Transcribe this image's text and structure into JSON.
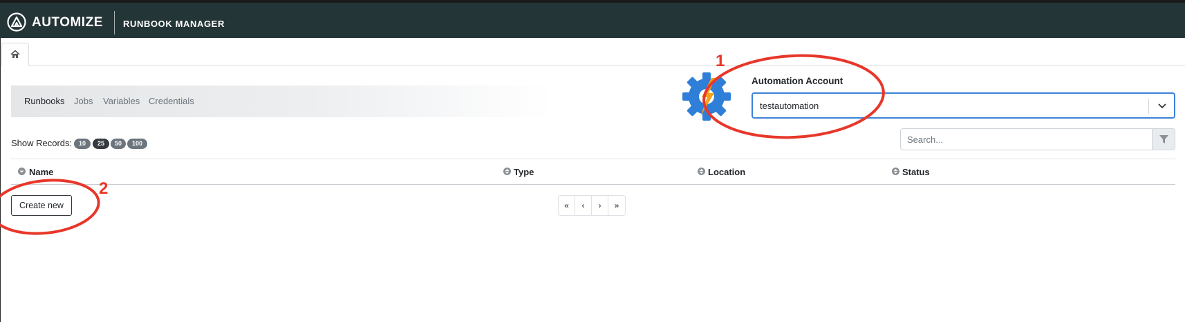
{
  "header": {
    "brand": "AUTOMIZE",
    "product": "RUNBOOK MANAGER"
  },
  "tabs": {
    "home_icon": "home-icon"
  },
  "subnav": {
    "items": [
      "Runbooks",
      "Jobs",
      "Variables",
      "Credentials"
    ],
    "active": "Runbooks"
  },
  "account": {
    "label": "Automation Account",
    "value": "testautomation"
  },
  "records": {
    "label": "Show Records:",
    "options": [
      "10",
      "25",
      "50",
      "100"
    ],
    "selected": "25"
  },
  "search": {
    "placeholder": "Search..."
  },
  "table": {
    "columns": [
      "Name",
      "Type",
      "Location",
      "Status"
    ]
  },
  "actions": {
    "create_new": "Create new"
  },
  "pagination": [
    "«",
    "‹",
    "›",
    "»"
  ],
  "annotations": [
    "1",
    "2"
  ],
  "colors": {
    "topbar": "#243537",
    "accent_blue": "#3b82d6",
    "annotation_red": "#e8372a",
    "pill_dark": "#343a40",
    "pill_gray": "#6c757d"
  }
}
